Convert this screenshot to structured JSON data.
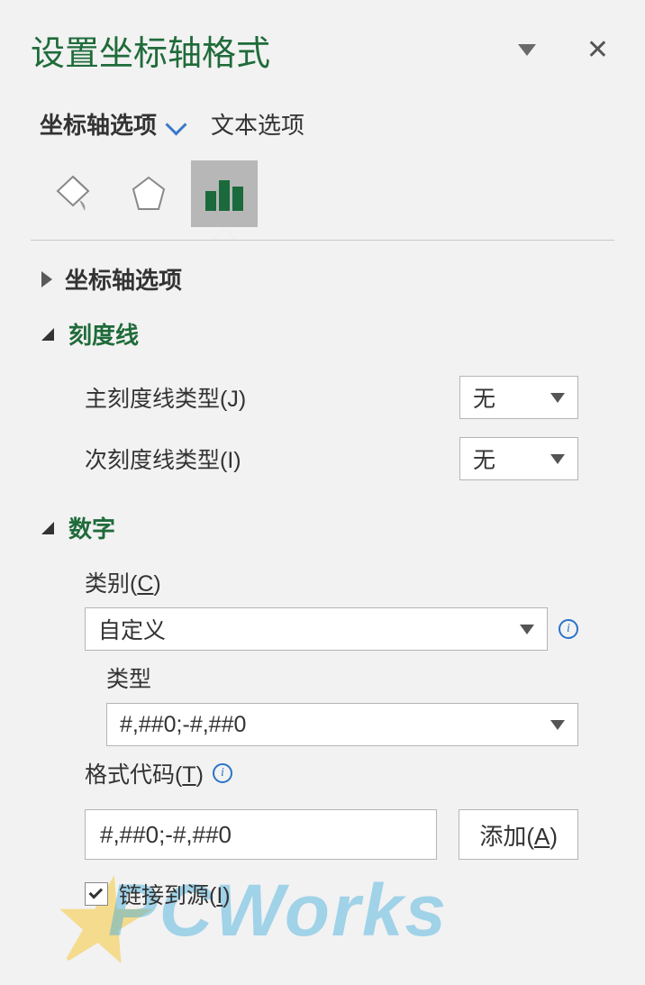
{
  "header": {
    "title": "设置坐标轴格式"
  },
  "tabs": {
    "axis_options": "坐标轴选项",
    "text_options": "文本选项"
  },
  "sections": {
    "axis_options": {
      "title": "坐标轴选项"
    },
    "tick_marks": {
      "title": "刻度线",
      "major_label": "主刻度线类型(J)",
      "minor_label": "次刻度线类型(I)",
      "major_value": "无",
      "minor_value": "无"
    },
    "number": {
      "title": "数字",
      "category_label_pre": "类别(",
      "category_label_u": "C",
      "category_label_post": ")",
      "category_value": "自定义",
      "type_label": "类型",
      "type_value": "#,##0;-#,##0",
      "format_code_label_pre": "格式代码(",
      "format_code_label_u": "T",
      "format_code_label_post": ")",
      "format_code_value": "#,##0;-#,##0",
      "add_button_pre": "添加(",
      "add_button_u": "A",
      "add_button_post": ")",
      "linked_label_pre": "链接到源(",
      "linked_label_u": "I",
      "linked_label_post": ")",
      "linked_checked": true
    }
  },
  "watermark": "PCWorks"
}
